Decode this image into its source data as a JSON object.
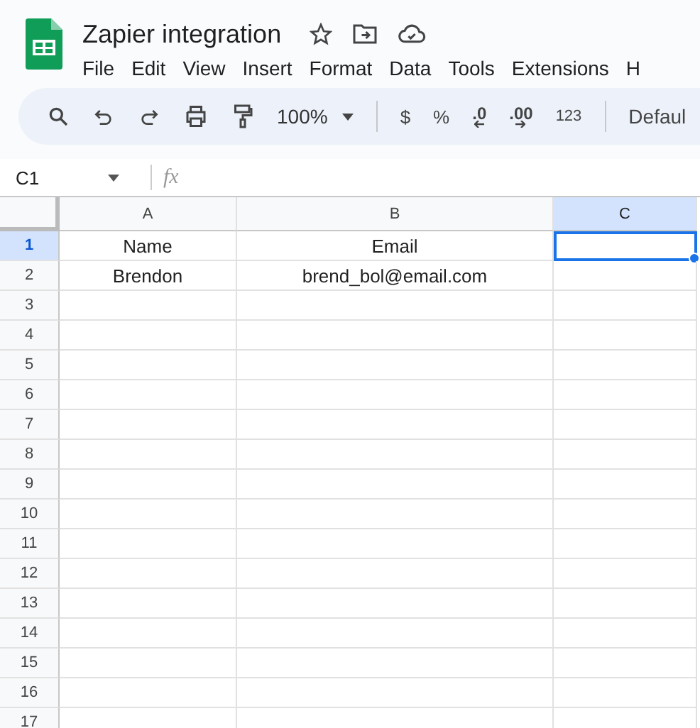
{
  "document": {
    "title": "Zapier integration"
  },
  "menu": [
    "File",
    "Edit",
    "View",
    "Insert",
    "Format",
    "Data",
    "Tools",
    "Extensions",
    "H"
  ],
  "toolbar": {
    "zoom": "100%",
    "currency": "$",
    "percent": "%",
    "decrease_decimal": ".0",
    "increase_decimal": ".00",
    "number_format": "123",
    "font": "Defaul"
  },
  "formula_bar": {
    "cell_reference": "C1",
    "fx": "fx"
  },
  "columns": [
    {
      "label": "A",
      "selected": false
    },
    {
      "label": "B",
      "selected": false
    },
    {
      "label": "C",
      "selected": true
    }
  ],
  "rows": [
    {
      "label": "1",
      "selected": true,
      "cells": [
        "Name",
        "Email"
      ]
    },
    {
      "label": "2",
      "selected": false,
      "cells": [
        "Brendon",
        "brend_bol@email.com"
      ]
    },
    {
      "label": "3",
      "selected": false
    },
    {
      "label": "4",
      "selected": false
    },
    {
      "label": "5",
      "selected": false
    },
    {
      "label": "6",
      "selected": false
    },
    {
      "label": "7",
      "selected": false
    },
    {
      "label": "8",
      "selected": false
    },
    {
      "label": "9",
      "selected": false
    },
    {
      "label": "10",
      "selected": false
    },
    {
      "label": "11",
      "selected": false
    },
    {
      "label": "12",
      "selected": false
    },
    {
      "label": "13",
      "selected": false
    },
    {
      "label": "14",
      "selected": false
    },
    {
      "label": "15",
      "selected": false
    },
    {
      "label": "16",
      "selected": false
    },
    {
      "label": "17",
      "selected": false
    }
  ]
}
